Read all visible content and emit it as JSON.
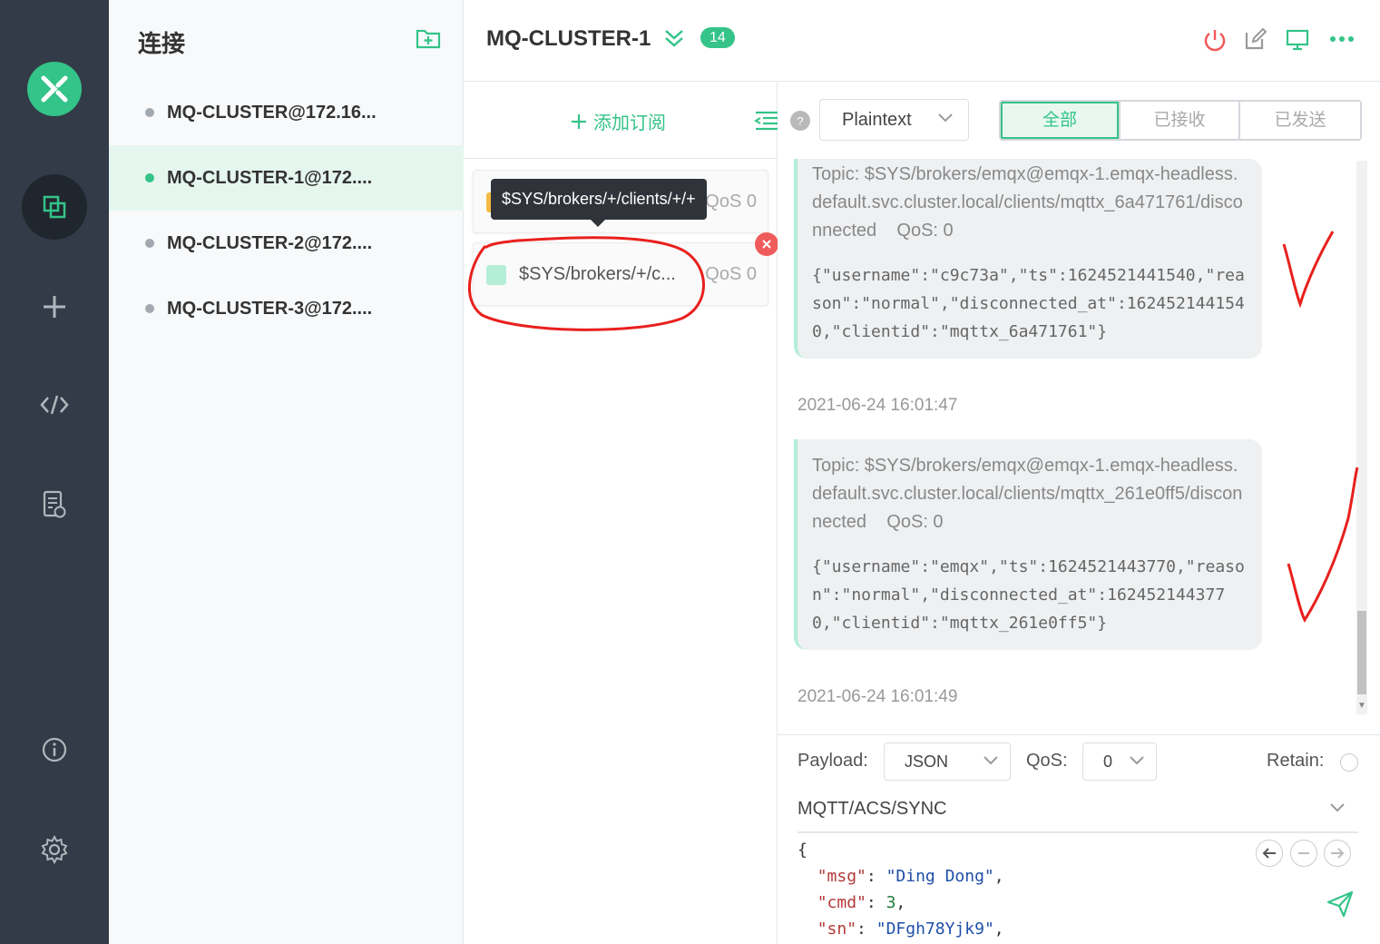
{
  "rail": {
    "logo_icon": "mqttx-logo-icon",
    "items": [
      "connections-icon",
      "add-icon",
      "script-icon",
      "log-icon",
      "about-icon",
      "settings-icon"
    ],
    "accent": "#34c388"
  },
  "connections": {
    "title": "连接",
    "items": [
      {
        "label": "MQ-CLUSTER@172.16...",
        "status": "disconnected"
      },
      {
        "label": "MQ-CLUSTER-1@172....",
        "status": "connected"
      },
      {
        "label": "MQ-CLUSTER-2@172....",
        "status": "disconnected"
      },
      {
        "label": "MQ-CLUSTER-3@172....",
        "status": "disconnected"
      }
    ]
  },
  "header": {
    "connection_name": "MQ-CLUSTER-1",
    "badge_count": "14"
  },
  "subscriptions": {
    "add_label": "添加订阅",
    "tooltip": "$SYS/brokers/+/clients/+/+",
    "items": [
      {
        "topic": "",
        "qos": "QoS 0",
        "color": "#f5b942"
      },
      {
        "topic": "$SYS/brokers/+/c...",
        "qos": "QoS 0",
        "color": "#b4eed7"
      }
    ]
  },
  "messages": {
    "format": "Plaintext",
    "filters": [
      "全部",
      "已接收",
      "已发送"
    ],
    "active_filter": "全部",
    "items": [
      {
        "topic": "Topic: $SYS/brokers/emqx@emqx-1.emqx-headless.default.svc.cluster.local/clients/mqttx_6a471761/disconnected",
        "qos": "QoS: 0",
        "payload": "{\"username\":\"c9c73a\",\"ts\":1624521441540,\"reason\":\"normal\",\"disconnected_at\":1624521441540,\"clientid\":\"mqttx_6a471761\"}",
        "time": "2021-06-24 16:01:47"
      },
      {
        "topic": "Topic: $SYS/brokers/emqx@emqx-1.emqx-headless.default.svc.cluster.local/clients/mqttx_261e0ff5/disconnected",
        "qos": "QoS: 0",
        "payload": "{\"username\":\"emqx\",\"ts\":1624521443770,\"reason\":\"normal\",\"disconnected_at\":1624521443770,\"clientid\":\"mqttx_261e0ff5\"}",
        "time": "2021-06-24 16:01:49"
      }
    ]
  },
  "publish": {
    "payload_label": "Payload:",
    "payload_format": "JSON",
    "qos_label": "QoS:",
    "qos_value": "0",
    "retain_label": "Retain:",
    "topic": "MQTT/ACS/SYNC",
    "code_lines": {
      "open": "{",
      "l1_key": "\"msg\"",
      "l1_val": "\"Ding Dong\"",
      "l2_key": "\"cmd\"",
      "l2_val": "3",
      "l3_key": "\"sn\"",
      "l3_val": "\"DFgh78Yjk9\""
    }
  }
}
